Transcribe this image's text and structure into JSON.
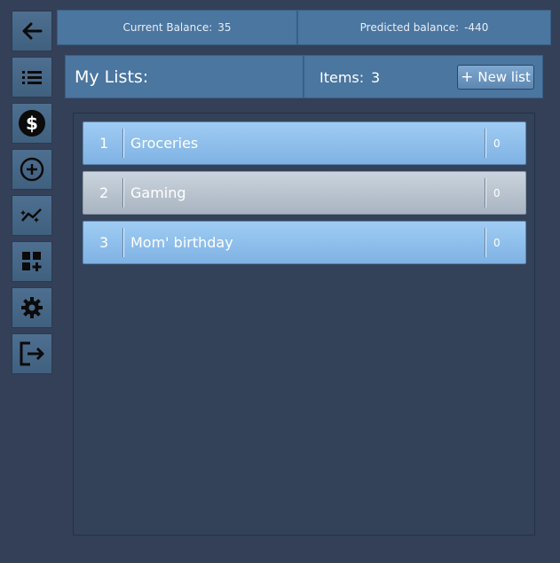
{
  "sidebar": {
    "buttons": [
      {
        "name": "back-button",
        "icon": "arrow-left-icon"
      },
      {
        "name": "lists-button",
        "icon": "list-icon"
      },
      {
        "name": "money-button",
        "icon": "dollar-icon"
      },
      {
        "name": "add-button",
        "icon": "plus-circle-icon"
      },
      {
        "name": "stats-button",
        "icon": "sparkline-icon"
      },
      {
        "name": "widgets-button",
        "icon": "add-widget-icon"
      },
      {
        "name": "settings-button",
        "icon": "gear-icon"
      },
      {
        "name": "logout-button",
        "icon": "logout-icon"
      }
    ]
  },
  "topbar": {
    "current_balance_label": "Current Balance:",
    "current_balance_value": "35",
    "predicted_balance_label": "Predicted balance:",
    "predicted_balance_value": "-440"
  },
  "list_header": {
    "title": "My Lists:",
    "items_label": "Items:",
    "items_count": "3",
    "new_list_label": "New list"
  },
  "lists": [
    {
      "number": "1",
      "name": "Groceries",
      "count": "0",
      "style": "blue"
    },
    {
      "number": "2",
      "name": "Gaming",
      "count": "0",
      "style": "grey"
    },
    {
      "number": "3",
      "name": "Mom' birthday",
      "count": "0",
      "style": "blue"
    }
  ],
  "colors": {
    "background": "#334057",
    "header_blue": "#4a76a0",
    "row_blue": "#8fbfea",
    "row_grey": "#b8c3ce"
  }
}
